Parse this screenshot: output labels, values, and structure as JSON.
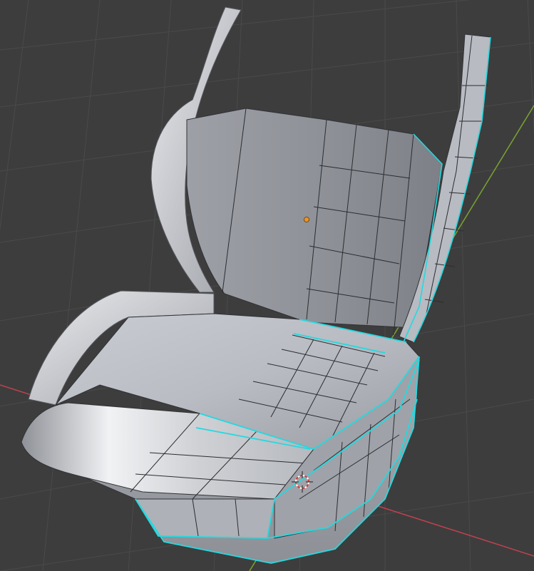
{
  "app": "3D viewport",
  "viewport": {
    "background": "#3d3d3d",
    "grid_color": "#4a4a4a",
    "x_axis_color": "#c0414f",
    "y_axis_color": "#7aa330"
  },
  "object": {
    "name": "seat-mesh",
    "shading": "solid",
    "edit_mode": true,
    "selected_edge_color": "#24d9e0",
    "origin_color": "#f2921d"
  },
  "icons": [
    "origin-dot-icon",
    "3d-cursor-icon"
  ]
}
